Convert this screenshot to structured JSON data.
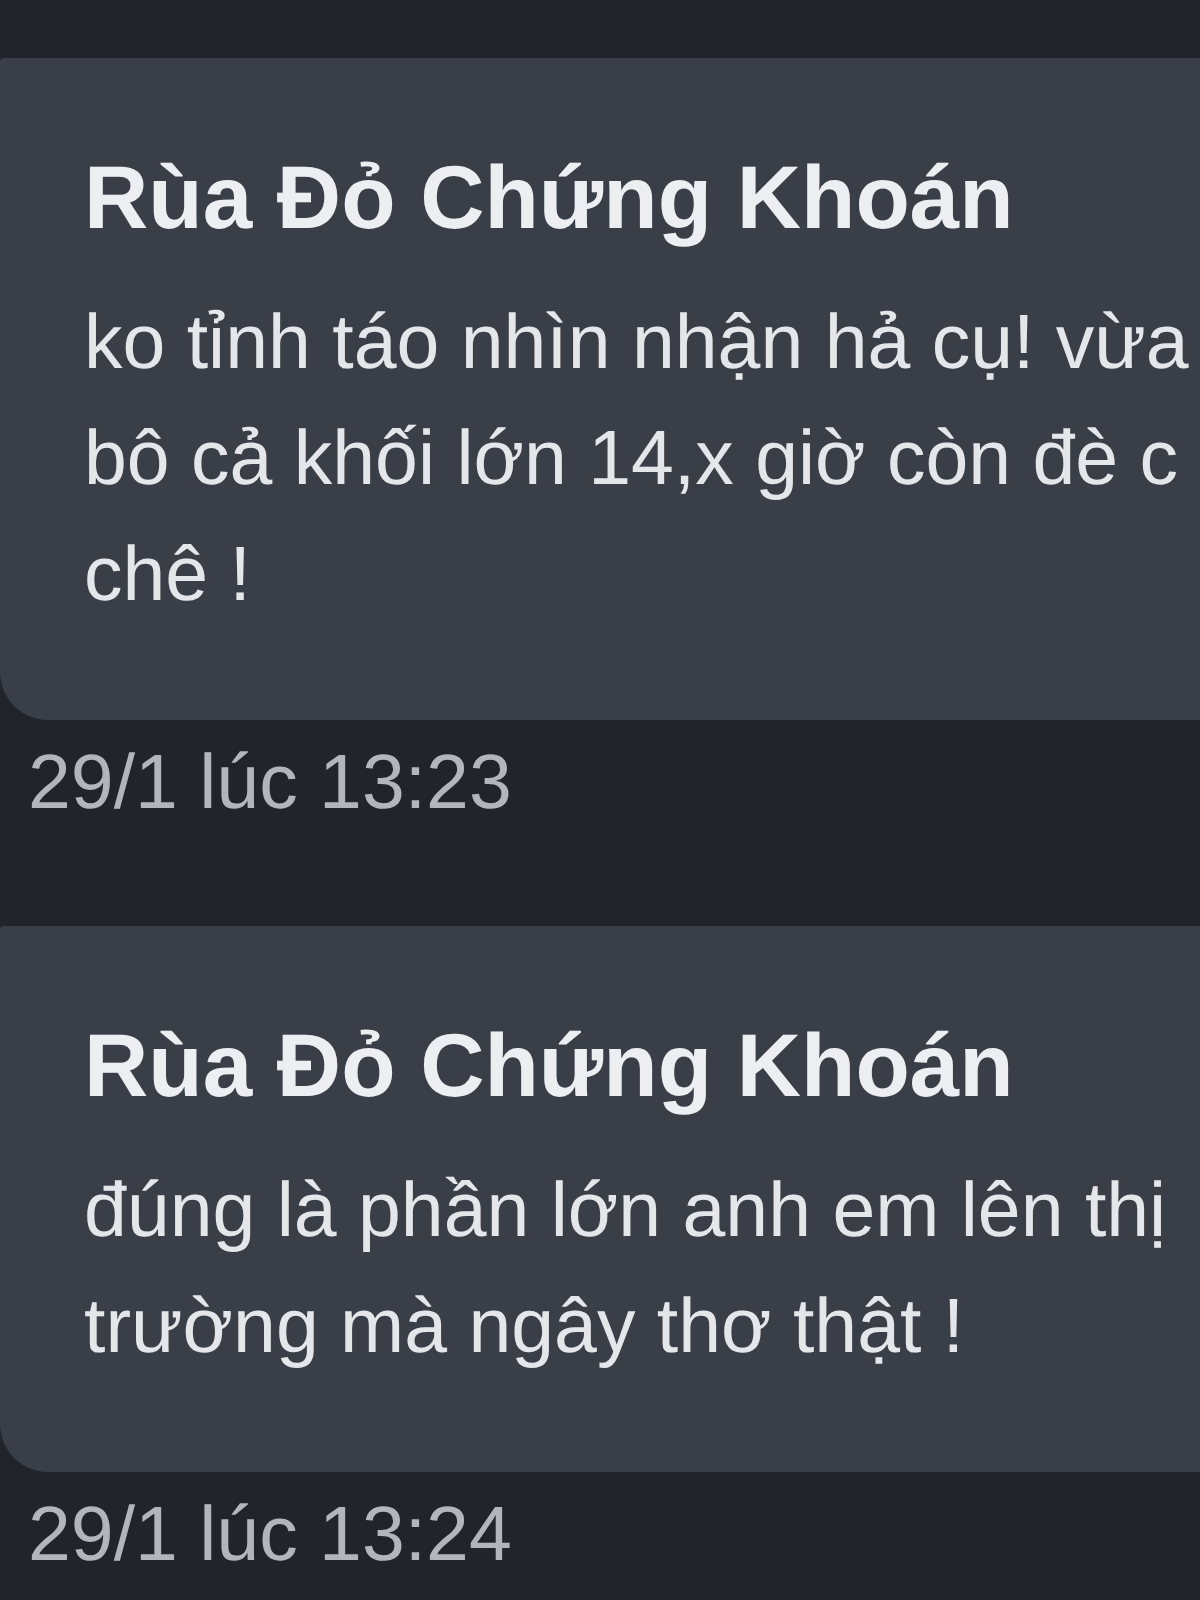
{
  "comments": [
    {
      "author": "Rùa Đỏ Chứng Khoán",
      "text_lines": [
        "ko tỉnh táo nhìn nhận hả cụ! vừa",
        "bô cả khối lớn 14,x giờ còn đè c",
        "chê !"
      ],
      "timestamp": "29/1 lúc 13:23"
    },
    {
      "author": "Rùa Đỏ Chứng Khoán",
      "text_lines": [
        "đúng là phần lớn anh em lên thị",
        "trường mà ngây thơ thật !"
      ],
      "timestamp": "29/1 lúc 13:24"
    }
  ]
}
